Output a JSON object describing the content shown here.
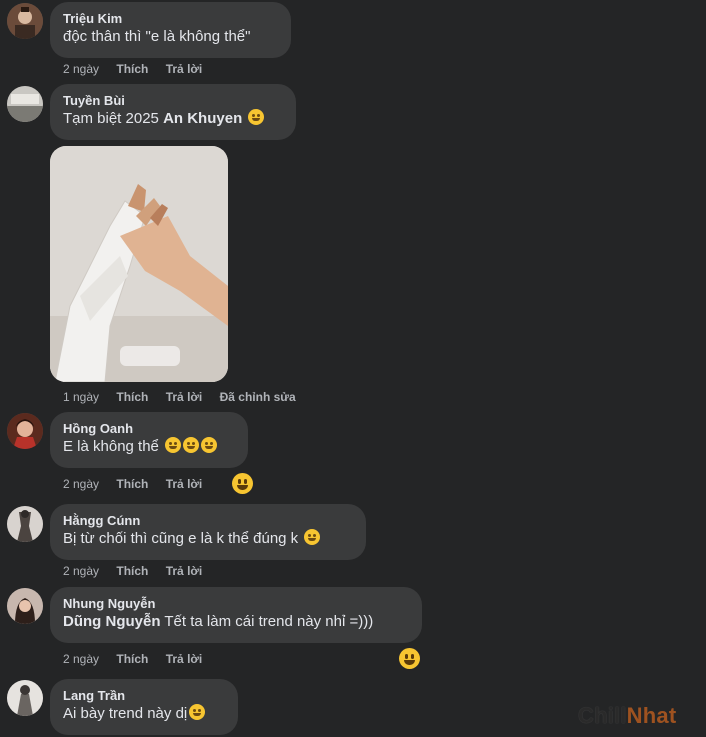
{
  "comments": [
    {
      "author": "Triệu Kim",
      "text": "độc thân thì \"e là không thể\"",
      "meta": {
        "time": "2 ngày",
        "like": "Thích",
        "reply": "Trả lời"
      }
    },
    {
      "author": "Tuyền Bùi",
      "text_before": "Tạm biệt 2025 ",
      "tag": "An Khuyen",
      "meta": {
        "time": "1 ngày",
        "like": "Thích",
        "reply": "Trả lời",
        "edited": "Đã chỉnh sửa"
      }
    },
    {
      "author": "Hồng Oanh",
      "text": "E là không thể",
      "meta": {
        "time": "2 ngày",
        "like": "Thích",
        "reply": "Trả lời"
      }
    },
    {
      "author": "Hằngg Cúnn",
      "text": "Bị từ chối thì cũng e là k thể đúng k",
      "meta": {
        "time": "2 ngày",
        "like": "Thích",
        "reply": "Trả lời"
      }
    },
    {
      "author": "Nhung Nguyễn",
      "tag": "Dũng Nguyễn",
      "text_after": " Tết ta làm cái trend này nhỉ =)))",
      "meta": {
        "time": "2 ngày",
        "like": "Thích",
        "reply": "Trả lời"
      }
    },
    {
      "author": "Lang Trần",
      "text": "Ai bày trend này dị",
      "meta": {}
    }
  ],
  "watermark": {
    "part1": "Chill",
    "part2": "Nhat"
  },
  "colors": {
    "background": "#242526",
    "bubble": "#3a3b3c",
    "meta": "#b0b3b8",
    "emoji": "#f7c531"
  }
}
